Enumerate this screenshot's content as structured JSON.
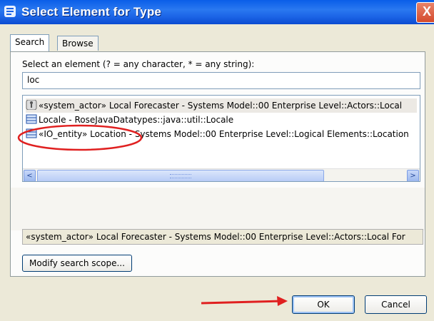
{
  "window": {
    "title": "Select Element for Type",
    "close_glyph": "X"
  },
  "tabs": [
    {
      "label": "Search",
      "active": true
    },
    {
      "label": "Browse",
      "active": false
    }
  ],
  "search": {
    "instruction": "Select an element (? = any character, * = any string):",
    "value": "loc"
  },
  "results": [
    {
      "icon": "actor-icon",
      "text": "«system_actor» Local Forecaster - Systems Model::00 Enterprise Level::Actors::Local"
    },
    {
      "icon": "class-icon",
      "text": "Locale - RoseJavaDatatypes::java::util::Locale"
    },
    {
      "icon": "class-icon",
      "text": "«IO_entity» Location - Systems Model::00 Enterprise Level::Logical Elements::Location"
    }
  ],
  "scrollbar": {
    "left_glyph": "<",
    "right_glyph": ">"
  },
  "status_text": "«system_actor» Local Forecaster - Systems Model::00 Enterprise Level::Actors::Local For",
  "buttons": {
    "modify": "Modify search scope...",
    "ok": "OK",
    "cancel": "Cancel"
  },
  "colors": {
    "title_bar": "#1b63e6",
    "annotation": "#e02020",
    "selection_bg": "#ece9e4"
  }
}
